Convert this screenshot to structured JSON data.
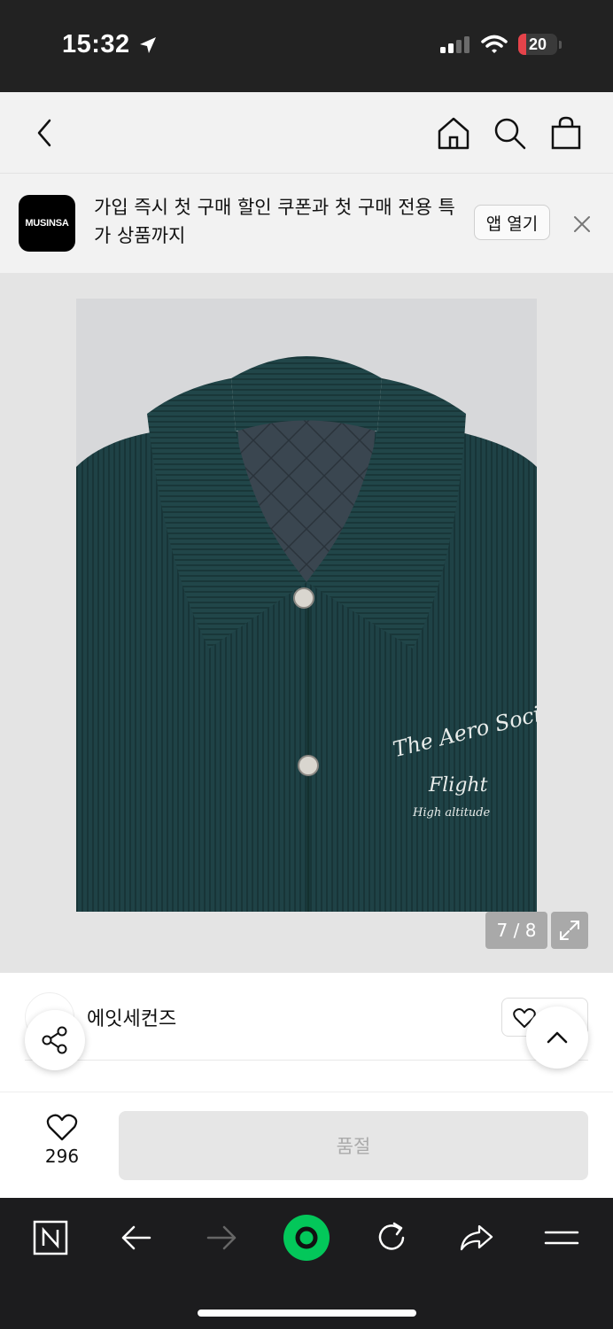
{
  "status_bar": {
    "time": "15:32",
    "battery_level": "20",
    "battery_fraction": 0.2,
    "icons": [
      "location-arrow-icon",
      "signal-icon",
      "wifi-icon",
      "battery-icon"
    ]
  },
  "header": {
    "icons": [
      "back-icon",
      "home-icon",
      "search-icon",
      "shopping-bag-icon"
    ]
  },
  "banner": {
    "logo_text": "MUSINSA",
    "message": "가입 즉시 첫 구매 할인 쿠폰과 첫 구매 전용 특가 상품까지",
    "open_app_label": "앱 열기",
    "close_icon": "close-icon"
  },
  "gallery": {
    "image_text_line1": "The Aero Society",
    "image_text_line2": "Flight",
    "image_text_line3": "High altitude",
    "pager": "7 / 8",
    "expand_icon": "expand-icon",
    "colors": {
      "jacket": "#1e4044",
      "background": "#d7d8da"
    }
  },
  "brand": {
    "name": "에잇세컨즈",
    "share_icon": "share-icon",
    "top_icon": "chevron-up-icon",
    "like_icon": "heart-icon"
  },
  "purchase": {
    "like_count": "296",
    "soldout_label": "품절"
  },
  "browser_bar": {
    "icons": [
      "naver-n-icon",
      "back-arrow-icon",
      "forward-arrow-icon",
      "green-circle-icon",
      "refresh-icon",
      "share-arrow-icon",
      "menu-icon"
    ],
    "accent": "#03c75a"
  }
}
